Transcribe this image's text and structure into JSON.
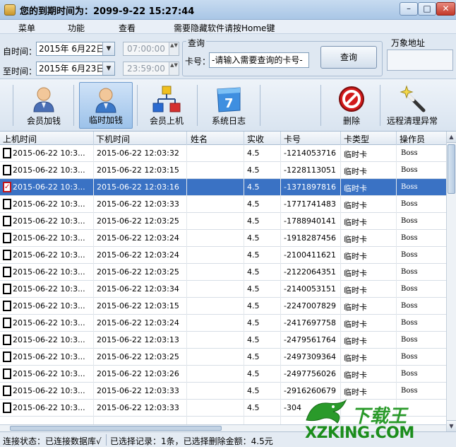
{
  "window": {
    "title": "您的到期时间为：2099-9-22 15:27:44",
    "min_label": "–",
    "max_label": "□",
    "close_label": "✕"
  },
  "menu": {
    "items": [
      "菜单",
      "功能",
      "查看",
      "需要隐藏软件请按Home键"
    ]
  },
  "query": {
    "start_label": "自时间：",
    "end_label": "至时间：",
    "start_date": "2015年 6月22日",
    "end_date": "2015年 6月23日",
    "start_time": "07:00:00",
    "end_time": "23:59:00",
    "group_label": "查询",
    "card_label": "卡号：",
    "card_placeholder": "-请输入需要查询的卡号-",
    "query_button": "查询",
    "address_label": "万象地址",
    "dropdown_glyph": "▼",
    "spin_glyph": "▲▼"
  },
  "toolbar": {
    "items": [
      {
        "label": "会员加钱",
        "icon": "member-user-icon"
      },
      {
        "label": "临时加钱",
        "icon": "temp-user-icon"
      },
      {
        "label": "会员上机",
        "icon": "network-icon"
      },
      {
        "label": "系统日志",
        "icon": "calendar-icon"
      },
      {
        "label": "删除",
        "icon": "delete-icon"
      },
      {
        "label": "远程清理异常",
        "icon": "magic-wand-icon"
      }
    ]
  },
  "table": {
    "columns": [
      "上机时间",
      "下机时间",
      "姓名",
      "实收",
      "卡号",
      "卡类型",
      "操作员"
    ],
    "rows": [
      {
        "checked": false,
        "start": "2015-06-22 10:3...",
        "end": "2015-06-22 12:03:32",
        "name": "",
        "paid": "4.5",
        "card": "-1214053716",
        "type": "临时卡",
        "op": "Boss"
      },
      {
        "checked": false,
        "start": "2015-06-22 10:3...",
        "end": "2015-06-22 12:03:15",
        "name": "",
        "paid": "4.5",
        "card": "-1228113051",
        "type": "临时卡",
        "op": "Boss"
      },
      {
        "checked": true,
        "start": "2015-06-22 10:3...",
        "end": "2015-06-22 12:03:16",
        "name": "",
        "paid": "4.5",
        "card": "-1371897816",
        "type": "临时卡",
        "op": "Boss"
      },
      {
        "checked": false,
        "start": "2015-06-22 10:3...",
        "end": "2015-06-22 12:03:33",
        "name": "",
        "paid": "4.5",
        "card": "-1771741483",
        "type": "临时卡",
        "op": "Boss"
      },
      {
        "checked": false,
        "start": "2015-06-22 10:3...",
        "end": "2015-06-22 12:03:25",
        "name": "",
        "paid": "4.5",
        "card": "-1788940141",
        "type": "临时卡",
        "op": "Boss"
      },
      {
        "checked": false,
        "start": "2015-06-22 10:3...",
        "end": "2015-06-22 12:03:24",
        "name": "",
        "paid": "4.5",
        "card": "-1918287456",
        "type": "临时卡",
        "op": "Boss"
      },
      {
        "checked": false,
        "start": "2015-06-22 10:3...",
        "end": "2015-06-22 12:03:24",
        "name": "",
        "paid": "4.5",
        "card": "-2100411621",
        "type": "临时卡",
        "op": "Boss"
      },
      {
        "checked": false,
        "start": "2015-06-22 10:3...",
        "end": "2015-06-22 12:03:25",
        "name": "",
        "paid": "4.5",
        "card": "-2122064351",
        "type": "临时卡",
        "op": "Boss"
      },
      {
        "checked": false,
        "start": "2015-06-22 10:3...",
        "end": "2015-06-22 12:03:34",
        "name": "",
        "paid": "4.5",
        "card": "-2140053151",
        "type": "临时卡",
        "op": "Boss"
      },
      {
        "checked": false,
        "start": "2015-06-22 10:3...",
        "end": "2015-06-22 12:03:15",
        "name": "",
        "paid": "4.5",
        "card": "-2247007829",
        "type": "临时卡",
        "op": "Boss"
      },
      {
        "checked": false,
        "start": "2015-06-22 10:3...",
        "end": "2015-06-22 12:03:24",
        "name": "",
        "paid": "4.5",
        "card": "-2417697758",
        "type": "临时卡",
        "op": "Boss"
      },
      {
        "checked": false,
        "start": "2015-06-22 10:3...",
        "end": "2015-06-22 12:03:13",
        "name": "",
        "paid": "4.5",
        "card": "-2479561764",
        "type": "临时卡",
        "op": "Boss"
      },
      {
        "checked": false,
        "start": "2015-06-22 10:3...",
        "end": "2015-06-22 12:03:25",
        "name": "",
        "paid": "4.5",
        "card": "-2497309364",
        "type": "临时卡",
        "op": "Boss"
      },
      {
        "checked": false,
        "start": "2015-06-22 10:3...",
        "end": "2015-06-22 12:03:26",
        "name": "",
        "paid": "4.5",
        "card": "-2497756026",
        "type": "临时卡",
        "op": "Boss"
      },
      {
        "checked": false,
        "start": "2015-06-22 10:3...",
        "end": "2015-06-22 12:03:33",
        "name": "",
        "paid": "4.5",
        "card": "-2916260679",
        "type": "临时卡",
        "op": "Boss"
      },
      {
        "checked": false,
        "start": "2015-06-22 10:3...",
        "end": "2015-06-22 12:03:33",
        "name": "",
        "paid": "4.5",
        "card": "-304",
        "type": "",
        "op": ""
      }
    ]
  },
  "status": {
    "connection": "连接状态：已连接数据库√",
    "selection": "已选择记录：1条，已选择删除金额：4.5元"
  },
  "watermark": {
    "brand": "下载王",
    "url": "XZKING.COM"
  },
  "colors": {
    "selected_row": "#3a72c4",
    "check_mark": "#d0161a",
    "watermark_green": "#2a9a2a"
  }
}
